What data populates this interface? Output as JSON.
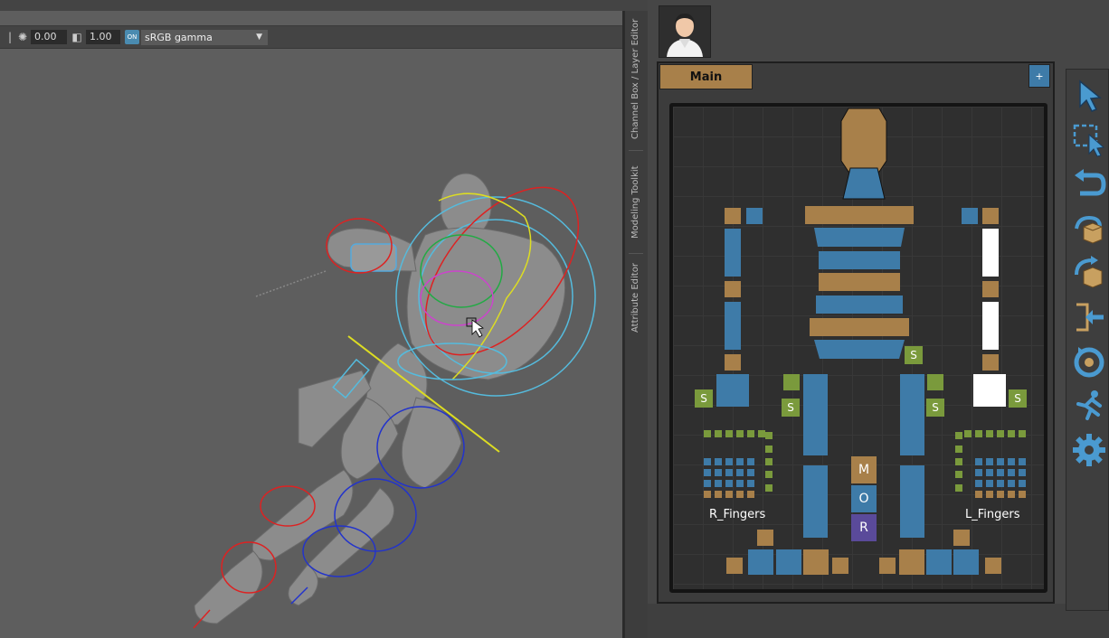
{
  "viewport": {
    "toolbar": {
      "exposure_value": "0.00",
      "gamma_value": "1.00",
      "toggle_label": "ON",
      "color_space": "sRGB gamma"
    }
  },
  "side_tabs": [
    "Channel Box / Layer Editor",
    "Modeling Toolkit",
    "Attribute Editor"
  ],
  "picker": {
    "tabs": [
      {
        "label": "Main"
      }
    ],
    "add_tab_label": "+",
    "labels": {
      "r_fingers": "R_Fingers",
      "l_fingers": "L_Fingers",
      "m": "M",
      "o": "O",
      "r": "R",
      "s": "S"
    }
  },
  "right_toolbar": {
    "icons": [
      "select-arrow-icon",
      "marquee-select-icon",
      "undo-icon",
      "load-pose-icon",
      "save-pose-icon",
      "mirror-pose-icon",
      "reset-icon",
      "animation-icon",
      "settings-gear-icon"
    ]
  },
  "colors": {
    "blue": "#3e7ba8",
    "orange": "#a8804a",
    "green": "#7a9a3c",
    "purple": "#5a4a9a"
  }
}
